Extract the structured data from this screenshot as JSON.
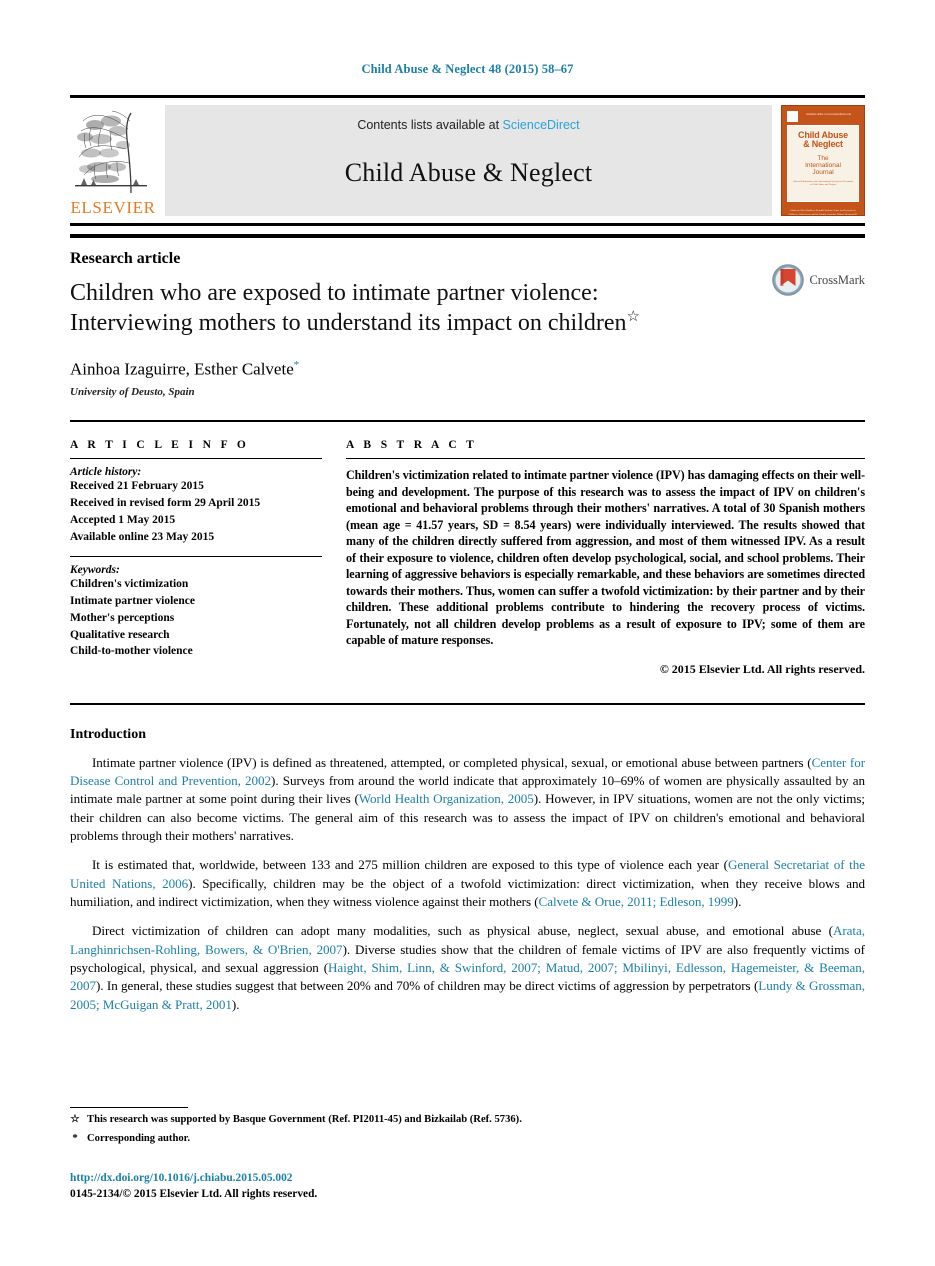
{
  "running_head": "Child Abuse & Neglect 48 (2015) 58–67",
  "masthead": {
    "publisher_wordmark": "ELSEVIER",
    "contents_prefix": "Contents lists available at",
    "contents_link": "ScienceDirect",
    "journal_name": "Child Abuse & Neglect",
    "cover": {
      "title_line1": "Child Abuse",
      "title_line2": "& Neglect",
      "subtitle_line1": "The",
      "subtitle_line2": "International",
      "subtitle_line3": "Journal",
      "micro_text": "Official Publication of the International Society for Prevention of Child Abuse and Neglect",
      "top_strip_left": "Available online at www.sciencedirect.com",
      "footer_text": "Editor-in-Chief\nKathleen Kendall-Tackett\nCenter for Research on Children, Adolescents and the Family\nAssociate Editors\nDesmond K. Runyan\nJohn M. Leventhal"
    }
  },
  "article": {
    "kind": "Research article",
    "title_line1": "Children who are exposed to intimate partner violence:",
    "title_line2": "Interviewing mothers to understand its impact on children",
    "title_mark": "☆",
    "authors": "Ainhoa Izaguirre, Esther Calvete",
    "author_mark": "*",
    "affiliation": "University of Deusto, Spain",
    "crossmark_label": "CrossMark"
  },
  "info": {
    "heading": "A R T I C L E   I N F O",
    "history_label": "Article history:",
    "history": [
      "Received 21 February 2015",
      "Received in revised form 29 April 2015",
      "Accepted 1 May 2015",
      "Available online 23 May 2015"
    ],
    "keywords_label": "Keywords:",
    "keywords": [
      "Children's victimization",
      "Intimate partner violence",
      "Mother's perceptions",
      "Qualitative research",
      "Child-to-mother violence"
    ]
  },
  "abstract": {
    "heading": "A B S T R A C T",
    "text": "Children's victimization related to intimate partner violence (IPV) has damaging effects on their well-being and development. The purpose of this research was to assess the impact of IPV on children's emotional and behavioral problems through their mothers' narratives. A total of 30 Spanish mothers (mean age = 41.57 years, SD = 8.54 years) were individually interviewed. The results showed that many of the children directly suffered from aggression, and most of them witnessed IPV. As a result of their exposure to violence, children often develop psychological, social, and school problems. Their learning of aggressive behaviors is especially remarkable, and these behaviors are sometimes directed towards their mothers. Thus, women can suffer a twofold victimization: by their partner and by their children. These additional problems contribute to hindering the recovery process of victims. Fortunately, not all children develop problems as a result of exposure to IPV; some of them are capable of mature responses.",
    "copyright": "© 2015 Elsevier Ltd. All rights reserved."
  },
  "introduction": {
    "heading": "Introduction",
    "paragraphs": [
      {
        "parts": [
          {
            "t": "Intimate partner violence (IPV) is defined as threatened, attempted, or completed physical, sexual, or emotional abuse between partners (",
            "link": false
          },
          {
            "t": "Center for Disease Control and Prevention, 2002",
            "link": true
          },
          {
            "t": "). Surveys from around the world indicate that approximately 10–69% of women are physically assaulted by an intimate male partner at some point during their lives (",
            "link": false
          },
          {
            "t": "World Health Organization, 2005",
            "link": true
          },
          {
            "t": "). However, in IPV situations, women are not the only victims; their children can also become victims. The general aim of this research was to assess the impact of IPV on children's emotional and behavioral problems through their mothers' narratives.",
            "link": false
          }
        ]
      },
      {
        "parts": [
          {
            "t": "It is estimated that, worldwide, between 133 and 275 million children are exposed to this type of violence each year (",
            "link": false
          },
          {
            "t": "General Secretariat of the United Nations, 2006",
            "link": true
          },
          {
            "t": "). Specifically, children may be the object of a twofold victimization: direct victimization, when they receive blows and humiliation, and indirect victimization, when they witness violence against their mothers (",
            "link": false
          },
          {
            "t": "Calvete & Orue, 2011; Edleson, 1999",
            "link": true
          },
          {
            "t": ").",
            "link": false
          }
        ]
      },
      {
        "parts": [
          {
            "t": "Direct victimization of children can adopt many modalities, such as physical abuse, neglect, sexual abuse, and emotional abuse (",
            "link": false
          },
          {
            "t": "Arata, Langhinrichsen-Rohling, Bowers, & O'Brien, 2007",
            "link": true
          },
          {
            "t": "). Diverse studies show that the children of female victims of IPV are also frequently victims of psychological, physical, and sexual aggression (",
            "link": false
          },
          {
            "t": "Haight, Shim, Linn, & Swinford, 2007; Matud, 2007; Mbilinyi, Edlesson, Hagemeister, & Beeman, 2007",
            "link": true
          },
          {
            "t": "). In general, these studies suggest that between 20% and 70% of children may be direct victims of aggression by perpetrators (",
            "link": false
          },
          {
            "t": "Lundy & Grossman, 2005; McGuigan & Pratt, 2001",
            "link": true
          },
          {
            "t": ").",
            "link": false
          }
        ]
      }
    ]
  },
  "footnotes": {
    "funding_mark": "☆",
    "funding_text": "This research was supported by Basque Government (Ref. PI2011-45) and Bizkailab (Ref. 5736).",
    "corresponding_mark": "*",
    "corresponding_text": "Corresponding author."
  },
  "footer": {
    "doi": "http://dx.doi.org/10.1016/j.chiabu.2015.05.002",
    "issn_copyright": "0145-2134/© 2015 Elsevier Ltd. All rights reserved."
  },
  "colors": {
    "link_blue": "#1c7fa8",
    "sciencedirect_blue": "#2aa3d6",
    "elsevier_orange": "#E87B22",
    "cover_orange": "#C4541A"
  }
}
